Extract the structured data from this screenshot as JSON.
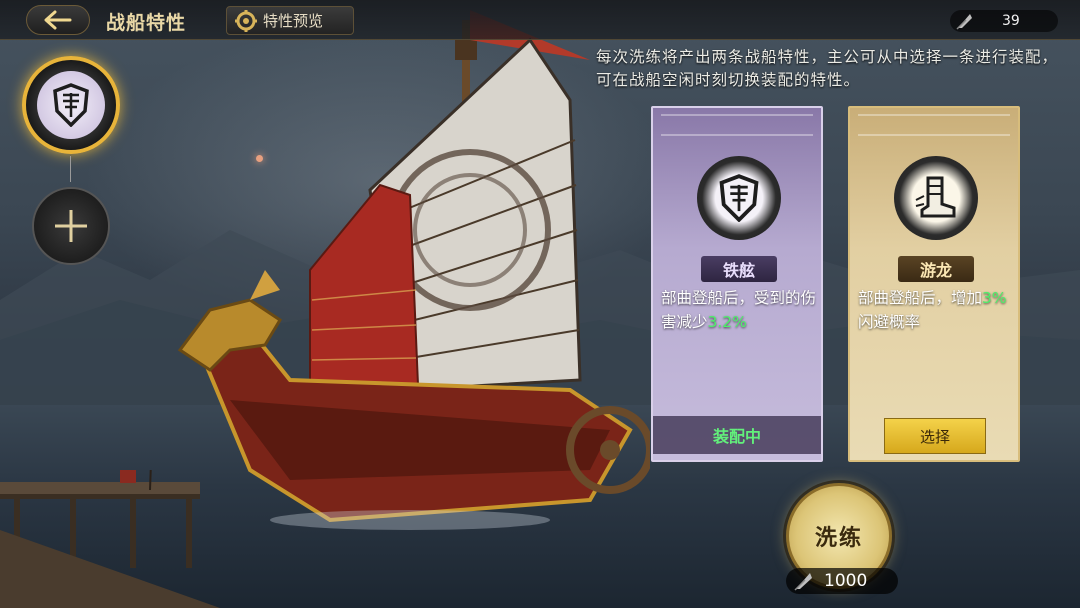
{
  "header": {
    "title": "战船特性",
    "preview_label": "特性预览",
    "currency_value": "39"
  },
  "description": "每次洗练将产出两条战船特性，主公可从中选择一条进行装配，可在战船空闲时刻切换装配的特性。",
  "slots": {
    "active_icon": "shield-icon",
    "add_icon": "plus-icon"
  },
  "cards": [
    {
      "name": "铁舷",
      "icon": "shield-icon",
      "effect_before": "部曲登船后，受到的伤害减少",
      "effect_value": "3.2%",
      "effect_after": "",
      "status_label": "装配中",
      "color": "#b6aad0"
    },
    {
      "name": "游龙",
      "icon": "boot-icon",
      "effect_before": "部曲登船后，增加",
      "effect_value": "3%",
      "effect_after": "闪避概率",
      "action_label": "选择",
      "color": "#e2cfa2"
    }
  ],
  "refine": {
    "label": "洗练",
    "cost": "1000"
  },
  "colors": {
    "highlight_green": "#4df06a",
    "gold_accent": "#e8b43a"
  }
}
